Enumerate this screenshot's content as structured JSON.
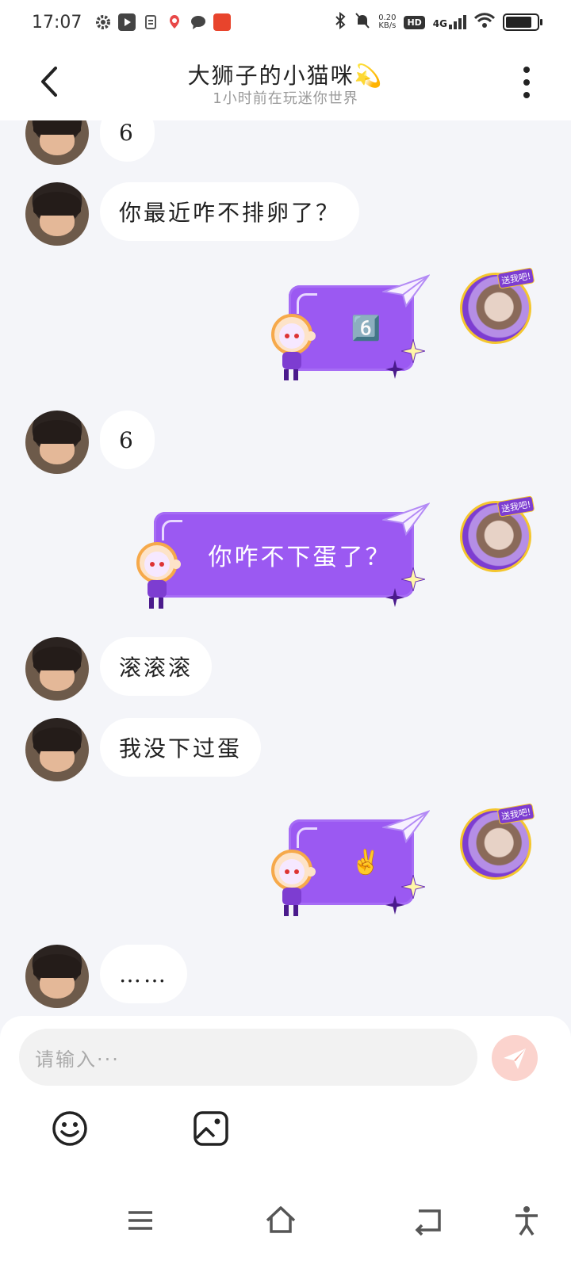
{
  "status_bar": {
    "time": "17:07",
    "net_speed_top": "0.20",
    "net_speed_bottom": "KB/s",
    "hd": "HD",
    "network": "4G",
    "battery_level": 0.85
  },
  "header": {
    "title": "大狮子的小猫咪💫",
    "subtitle": "1小时前在玩迷你世界"
  },
  "messages": [
    {
      "side": "left",
      "text": "6"
    },
    {
      "side": "left",
      "text": "你最近咋不排卵了？"
    },
    {
      "side": "right",
      "text": "6️⃣"
    },
    {
      "side": "left",
      "text": "6"
    },
    {
      "side": "right",
      "text": "你咋不下蛋了？"
    },
    {
      "side": "left",
      "text": "滚滚滚"
    },
    {
      "side": "left",
      "text": "我没下过蛋"
    },
    {
      "side": "right",
      "text": "✌️"
    },
    {
      "side": "left",
      "text": "……"
    }
  ],
  "avatar_badge": "送我吧!",
  "input": {
    "placeholder": "请输入···"
  },
  "colors": {
    "accent_purple": "#9b59f2",
    "send_button": "#fbd3cd",
    "background": "#f4f5f9"
  }
}
